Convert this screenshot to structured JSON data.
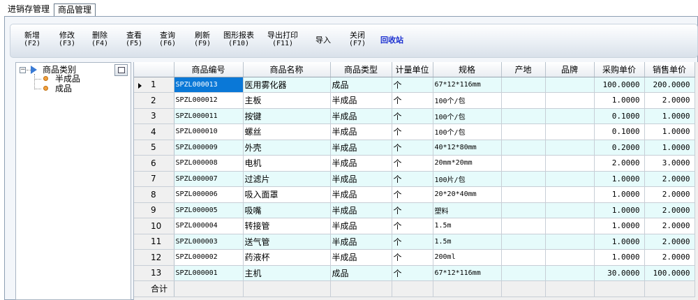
{
  "tabs": [
    {
      "label": "进销存管理"
    },
    {
      "label": "商品管理"
    }
  ],
  "toolbar": {
    "buttons": [
      {
        "label": "新增",
        "key": "(F2)"
      },
      {
        "label": "修改",
        "key": "(F3)"
      },
      {
        "label": "删除",
        "key": "(F4)"
      },
      {
        "label": "查看",
        "key": "(F5)"
      },
      {
        "label": "查询",
        "key": "(F6)"
      },
      {
        "label": "刷新",
        "key": "(F9)"
      },
      {
        "label": "图形报表",
        "key": "(F10)"
      },
      {
        "label": "导出打印",
        "key": "(F11)"
      },
      {
        "label": "导入"
      },
      {
        "label": "关闭",
        "key": "(F7)"
      },
      {
        "label": "回收站"
      }
    ]
  },
  "tree": {
    "root": "商品类别",
    "children": [
      "半成品",
      "成品"
    ]
  },
  "grid": {
    "columns": [
      "商品编号",
      "商品名称",
      "商品类型",
      "计量单位",
      "规格",
      "产地",
      "品牌",
      "采购单价",
      "销售单价"
    ],
    "rows": [
      {
        "n": "1",
        "code": "SPZL000013",
        "name": "医用雾化器",
        "type": "成品",
        "unit": "个",
        "spec": "67*12*116mm",
        "origin": "",
        "brand": "",
        "buy": "100.0000",
        "sell": "200.0000"
      },
      {
        "n": "2",
        "code": "SPZL000012",
        "name": "主板",
        "type": "半成品",
        "unit": "个",
        "spec": "100个/包",
        "origin": "",
        "brand": "",
        "buy": "1.0000",
        "sell": "2.0000"
      },
      {
        "n": "3",
        "code": "SPZL000011",
        "name": "按键",
        "type": "半成品",
        "unit": "个",
        "spec": "100个/包",
        "origin": "",
        "brand": "",
        "buy": "0.1000",
        "sell": "1.0000"
      },
      {
        "n": "4",
        "code": "SPZL000010",
        "name": "螺丝",
        "type": "半成品",
        "unit": "个",
        "spec": "100个/包",
        "origin": "",
        "brand": "",
        "buy": "0.1000",
        "sell": "1.0000"
      },
      {
        "n": "5",
        "code": "SPZL000009",
        "name": "外壳",
        "type": "半成品",
        "unit": "个",
        "spec": "40*12*80mm",
        "origin": "",
        "brand": "",
        "buy": "0.2000",
        "sell": "1.0000"
      },
      {
        "n": "6",
        "code": "SPZL000008",
        "name": "电机",
        "type": "半成品",
        "unit": "个",
        "spec": "20mm*20mm",
        "origin": "",
        "brand": "",
        "buy": "2.0000",
        "sell": "3.0000"
      },
      {
        "n": "7",
        "code": "SPZL000007",
        "name": "过滤片",
        "type": "半成品",
        "unit": "个",
        "spec": "100片/包",
        "origin": "",
        "brand": "",
        "buy": "1.0000",
        "sell": "2.0000"
      },
      {
        "n": "8",
        "code": "SPZL000006",
        "name": "吸入面罩",
        "type": "半成品",
        "unit": "个",
        "spec": "20*20*40mm",
        "origin": "",
        "brand": "",
        "buy": "1.0000",
        "sell": "2.0000"
      },
      {
        "n": "9",
        "code": "SPZL000005",
        "name": "吸嘴",
        "type": "半成品",
        "unit": "个",
        "spec": "塑料",
        "origin": "",
        "brand": "",
        "buy": "1.0000",
        "sell": "2.0000"
      },
      {
        "n": "10",
        "code": "SPZL000004",
        "name": "转接管",
        "type": "半成品",
        "unit": "个",
        "spec": "1.5m",
        "origin": "",
        "brand": "",
        "buy": "1.0000",
        "sell": "2.0000"
      },
      {
        "n": "11",
        "code": "SPZL000003",
        "name": "送气管",
        "type": "半成品",
        "unit": "个",
        "spec": "1.5m",
        "origin": "",
        "brand": "",
        "buy": "1.0000",
        "sell": "2.0000"
      },
      {
        "n": "12",
        "code": "SPZL000002",
        "name": "药液杯",
        "type": "半成品",
        "unit": "个",
        "spec": "200ml",
        "origin": "",
        "brand": "",
        "buy": "1.0000",
        "sell": "2.0000"
      },
      {
        "n": "13",
        "code": "SPZL000001",
        "name": "主机",
        "type": "成品",
        "unit": "个",
        "spec": "67*12*116mm",
        "origin": "",
        "brand": "",
        "buy": "30.0000",
        "sell": "100.0000"
      }
    ],
    "total_label": "合计"
  },
  "colors": {
    "odd_row": "#e6fbfb",
    "selected": "#0a78d7",
    "recycle_text": "#1a2fd0"
  }
}
